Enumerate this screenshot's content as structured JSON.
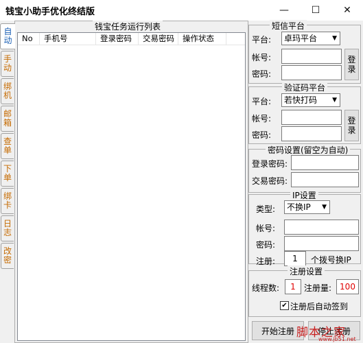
{
  "window": {
    "title": "钱宝小助手优化终结版",
    "minimize": "—",
    "maximize": "☐",
    "close": "✕"
  },
  "tabs": [
    "自动",
    "手动",
    "绑机",
    "邮箱",
    "查单",
    "下单",
    "绑卡",
    "日志",
    "改密"
  ],
  "task_list": {
    "title": "钱宝任务运行列表",
    "columns": [
      "No",
      "手机号",
      "登录密码",
      "交易密码",
      "操作状态"
    ]
  },
  "sms_platform": {
    "title": "短信平台",
    "platform_label": "平台:",
    "platform_value": "卓玛平台",
    "account_label": "帐号:",
    "password_label": "密码:",
    "login_button": "登录"
  },
  "captcha_platform": {
    "title": "验证码平台",
    "platform_label": "平台:",
    "platform_value": "若快打码",
    "account_label": "帐号:",
    "password_label": "密码:",
    "login_button": "登录"
  },
  "password_settings": {
    "title": "密码设置(留空为自动)",
    "login_label": "登录密码:",
    "trade_label": "交易密码:"
  },
  "ip_settings": {
    "title": "IP设置",
    "type_label": "类型:",
    "type_value": "不换IP",
    "account_label": "帐号:",
    "password_label": "密码:",
    "register_label": "注册:",
    "register_value": "1",
    "register_suffix": "个拨号换IP"
  },
  "register_settings": {
    "title": "注册设置",
    "threads_label": "线程数:",
    "threads_value": "1",
    "count_label": "注册量:",
    "count_value": "100",
    "auto_checkin_label": "注册后自动签到",
    "auto_checkin_checked": "✔"
  },
  "actions": {
    "start_button": "开始注册",
    "stop_button": "停止注册"
  },
  "watermark": {
    "main": "脚本之家",
    "sub": "www.jb51.net"
  }
}
